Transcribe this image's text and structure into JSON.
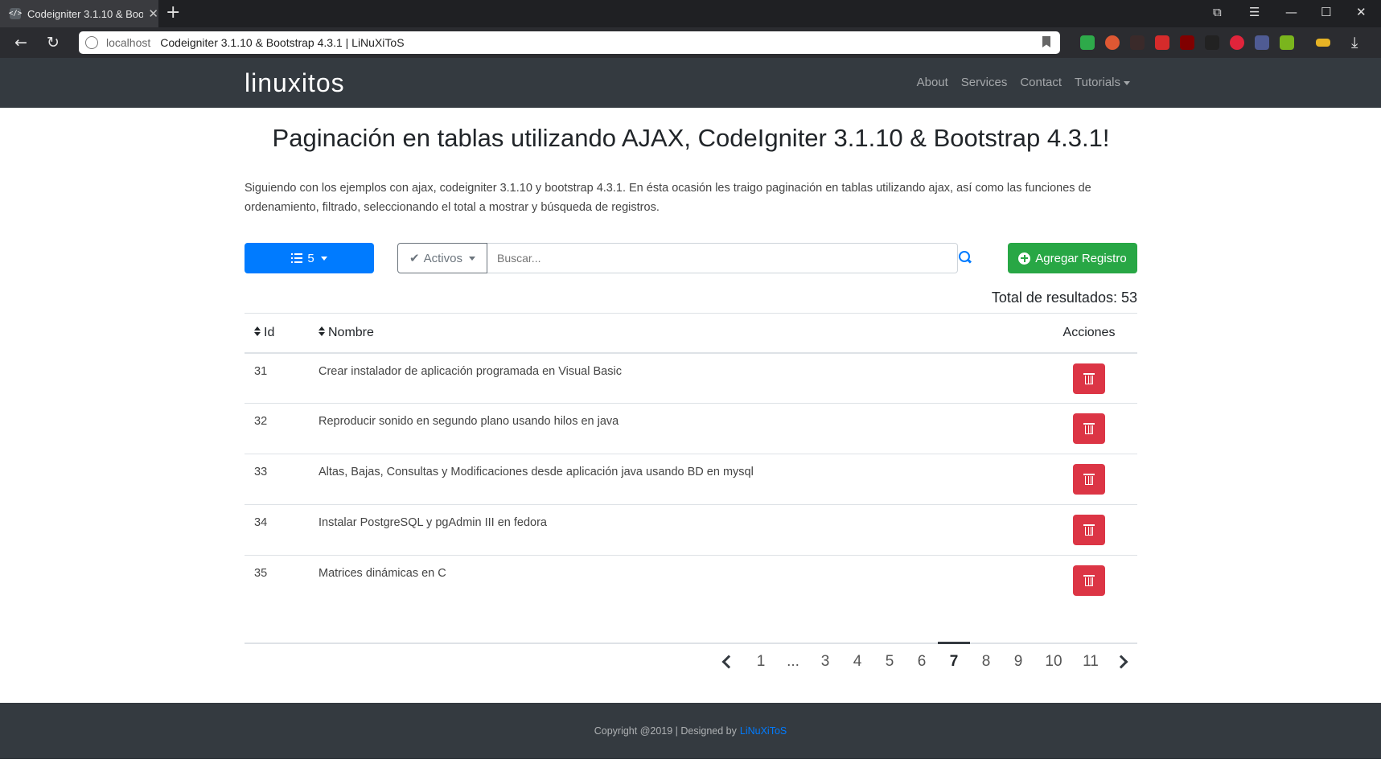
{
  "browser": {
    "tab_title": "Codeigniter 3.1.10 & Bootstrap 4.3.1 | LiNuXiToS",
    "url_host": "localhost",
    "url_title": "Codeigniter 3.1.10 & Bootstrap 4.3.1 | LiNuXiToS"
  },
  "navbar": {
    "brand": "linuxitos",
    "links": [
      "About",
      "Services",
      "Contact",
      "Tutorials"
    ]
  },
  "main": {
    "heading": "Paginación en tablas utilizando AJAX, CodeIgniter 3.1.10 & Bootstrap 4.3.1!",
    "lead": "Siguiendo con los ejemplos con ajax, codeigniter 3.1.10 y bootstrap 4.3.1. En ésta ocasión les traigo paginación en tablas utilizando ajax, así como las funciones de ordenamiento, filtrado, seleccionando el total a mostrar y búsqueda de registros.",
    "per_page": "5",
    "filter": "Activos",
    "search_placeholder": "Buscar...",
    "add_button": "Agregar Registro",
    "total": "Total de resultados: 53"
  },
  "table": {
    "headers": [
      "Id",
      "Nombre",
      "Acciones"
    ],
    "rows": [
      {
        "id": "31",
        "nombre": "Crear instalador de aplicación programada en Visual Basic"
      },
      {
        "id": "32",
        "nombre": "Reproducir sonido en segundo plano usando hilos en java"
      },
      {
        "id": "33",
        "nombre": "Altas, Bajas, Consultas y Modificaciones desde aplicación java usando BD en mysql"
      },
      {
        "id": "34",
        "nombre": "Instalar PostgreSQL y pgAdmin III en fedora"
      },
      {
        "id": "35",
        "nombre": "Matrices dinámicas en C"
      }
    ]
  },
  "pagination": {
    "pages": [
      "1",
      "...",
      "3",
      "4",
      "5",
      "6",
      "7",
      "8",
      "9",
      "10",
      "11"
    ],
    "active": "7"
  },
  "footer": {
    "text": "Copyright @2019 | Designed by",
    "link": "LiNuXiToS"
  },
  "colors": {
    "primary": "#007bff",
    "success": "#28a745",
    "danger": "#dc3545",
    "dark": "#343a40"
  }
}
